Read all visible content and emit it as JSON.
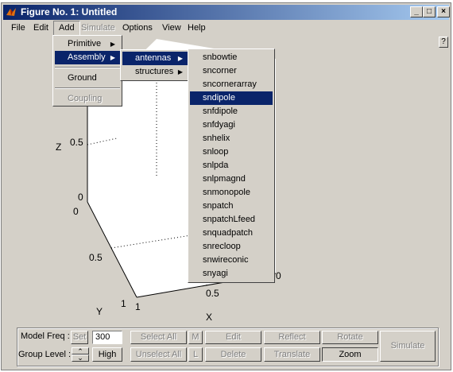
{
  "window": {
    "title": "Figure No. 1: Untitled",
    "minimize": "_",
    "maximize": "□",
    "close": "×"
  },
  "menubar": {
    "items": [
      {
        "label": "File",
        "enabled": true
      },
      {
        "label": "Edit",
        "enabled": true
      },
      {
        "label": "Add",
        "enabled": true,
        "open": true
      },
      {
        "label": "Simulate",
        "enabled": false
      },
      {
        "label": "Options",
        "enabled": true
      },
      {
        "label": "View",
        "enabled": true
      },
      {
        "label": "Help",
        "enabled": true
      }
    ],
    "help_button": "?"
  },
  "add_menu": {
    "items": [
      {
        "label": "Primitive",
        "submenu": true
      },
      {
        "label": "Assembly",
        "submenu": true,
        "highlighted": true
      },
      {
        "label": "Ground",
        "submenu": false
      },
      {
        "label": "Coupling",
        "submenu": false,
        "enabled": false
      }
    ]
  },
  "assembly_menu": {
    "items": [
      {
        "label": "antennas",
        "submenu": true,
        "highlighted": true
      },
      {
        "label": "structures",
        "submenu": true
      }
    ]
  },
  "antennas_menu": {
    "selected": "sndipole",
    "items": [
      "snbowtie",
      "sncorner",
      "sncornerarray",
      "sndipole",
      "snfdipole",
      "snfdyagi",
      "snhelix",
      "snloop",
      "snlpda",
      "snlpmagnd",
      "snmonopole",
      "snpatch",
      "snpatchLfeed",
      "snquadpatch",
      "snrecloop",
      "snwireconic",
      "snyagi"
    ]
  },
  "plot": {
    "z_label": "Z",
    "y_label": "Y",
    "x_label": "X",
    "ticks": {
      "z_05": "0.5",
      "z_0": "0",
      "y_0": "0",
      "y_05": "0.5",
      "y_1": "1",
      "x_1": "1",
      "x_05": "0.5",
      "x_0": "0"
    }
  },
  "controls": {
    "model_freq_label": "Model Freq :",
    "set_button": "Set",
    "freq_value": "300",
    "group_level_label": "Group Level :",
    "level_up": "⌃",
    "level_down": "⌄",
    "level_value": "High",
    "select_all": "Select All",
    "m_button": "M",
    "edit_button": "Edit",
    "reflect_button": "Reflect",
    "rotate_button": "Rotate",
    "unselect_all": "Unselect All",
    "l_button": "L",
    "delete_button": "Delete",
    "translate_button": "Translate",
    "zoom_button": "Zoom",
    "simulate_button": "Simulate"
  },
  "colors": {
    "title_start": "#0a246a",
    "title_end": "#a6caf0",
    "face": "#d4d0c8",
    "highlight": "#0a246a"
  }
}
